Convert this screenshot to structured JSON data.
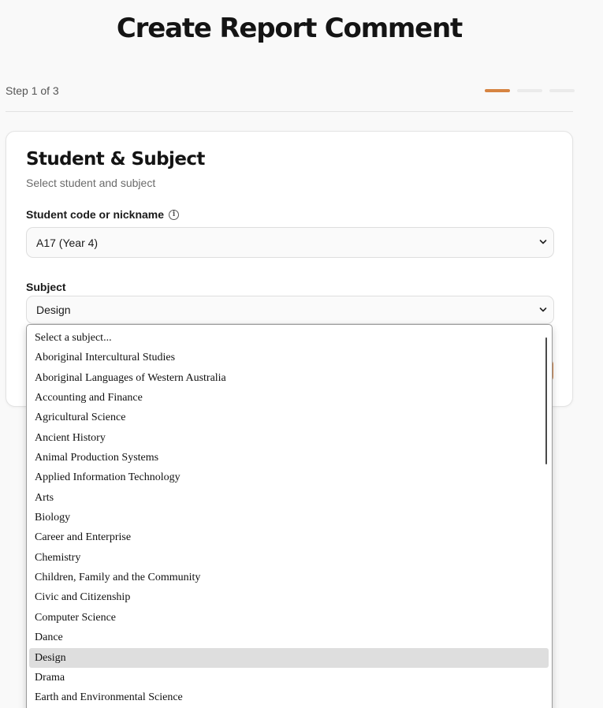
{
  "header": {
    "title": "Create Report Comment"
  },
  "stepper": {
    "label": "Step 1 of 3",
    "current": 1,
    "total": 3,
    "accent": "#d68442"
  },
  "card": {
    "title": "Student & Subject",
    "subtitle": "Select student and subject",
    "student": {
      "label": "Student code or nickname",
      "value": "A17 (Year 4)"
    },
    "subject": {
      "label": "Subject",
      "value": "Design"
    }
  },
  "dropdown": {
    "selected": "Design",
    "options": [
      "Select a subject...",
      "Aboriginal Intercultural Studies",
      "Aboriginal Languages of Western Australia",
      "Accounting and Finance",
      "Agricultural Science",
      "Ancient History",
      "Animal Production Systems",
      "Applied Information Technology",
      "Arts",
      "Biology",
      "Career and Enterprise",
      "Chemistry",
      "Children, Family and the Community",
      "Civic and Citizenship",
      "Computer Science",
      "Dance",
      "Design",
      "Drama",
      "Earth and Environmental Science"
    ]
  },
  "icons": {
    "info": "info-icon",
    "chevron": "chevron-down-icon"
  }
}
